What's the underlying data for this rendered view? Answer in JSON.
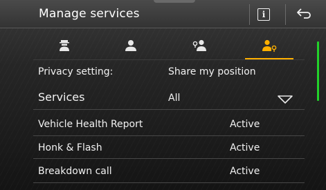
{
  "header": {
    "title": "Manage services",
    "info_icon_glyph": "i",
    "info_icon": "info-icon",
    "back_icon": "back-arrow-icon"
  },
  "tabs": [
    {
      "icon": "incognito-person-icon",
      "active": false
    },
    {
      "icon": "person-icon",
      "active": false
    },
    {
      "icon": "person-location-icon",
      "active": false
    },
    {
      "icon": "person-location-gear-icon",
      "active": true
    }
  ],
  "settings": {
    "privacy_label": "Privacy setting:",
    "privacy_value": "Share my position",
    "services_label": "Services",
    "services_value": "All"
  },
  "services": [
    {
      "name": "Vehicle Health Report",
      "status": "Active"
    },
    {
      "name": "Honk & Flash",
      "status": "Active"
    },
    {
      "name": "Breakdown call",
      "status": "Active"
    }
  ],
  "colors": {
    "accent": "#ffb000",
    "scrollbar": "#22d22a",
    "text": "#f2f2f2"
  }
}
